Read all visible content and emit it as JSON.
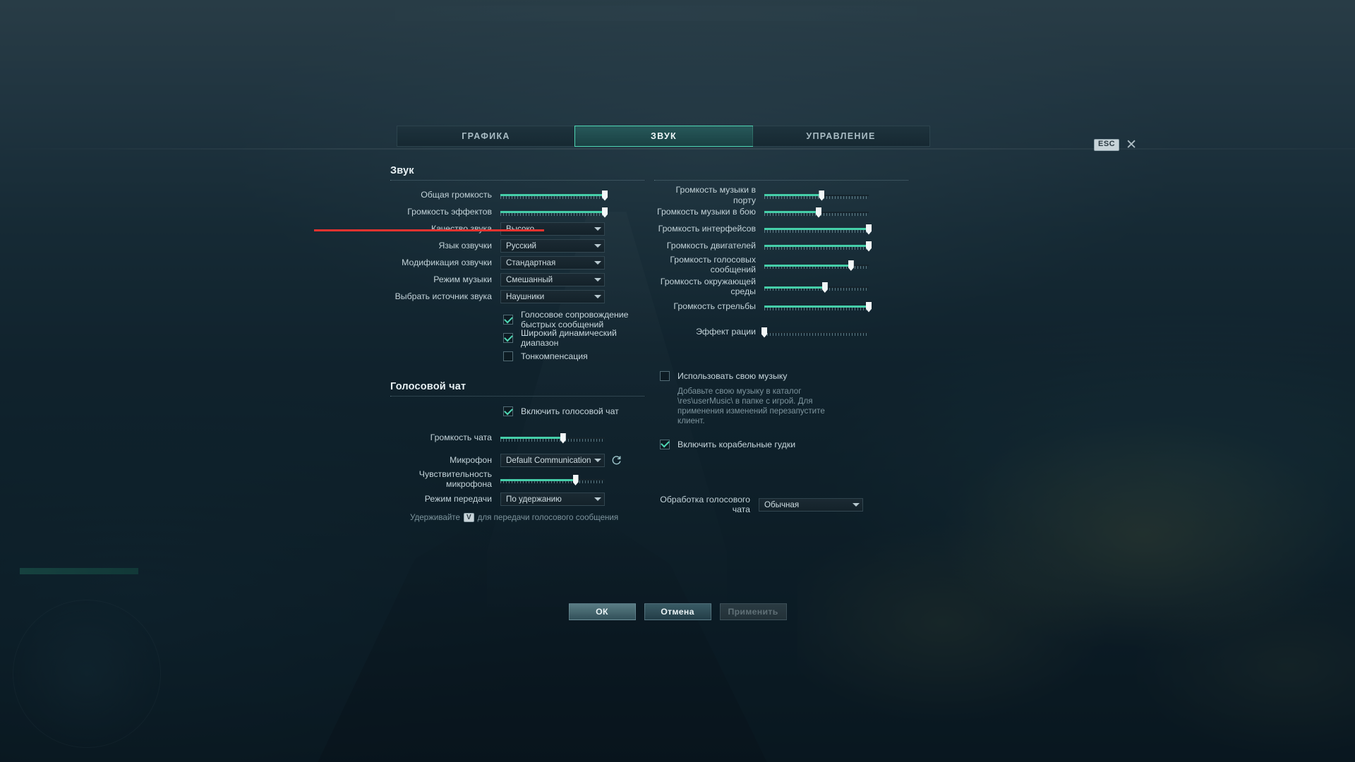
{
  "tabs": [
    {
      "id": "graphics",
      "label": "ГРАФИКА",
      "active": false
    },
    {
      "id": "sound",
      "label": "ЗВУК",
      "active": true
    },
    {
      "id": "controls",
      "label": "УПРАВЛЕНИЕ",
      "active": false
    }
  ],
  "esc_close": {
    "key_label": "ESC",
    "close_glyph": "✕"
  },
  "sections": {
    "sound_title": "Звук",
    "voice_chat_title": "Голосовой чат"
  },
  "left_column": {
    "sliders": [
      {
        "label": "Общая громкость",
        "value": 100
      },
      {
        "label": "Громкость эффектов",
        "value": 100
      }
    ],
    "dropdowns": [
      {
        "label": "Качество звука",
        "value": "Высоко"
      },
      {
        "label": "Язык озвучки",
        "value": "Русский"
      },
      {
        "label": "Модификация озвучки",
        "value": "Стандартная"
      },
      {
        "label": "Режим музыки",
        "value": "Смешанный"
      },
      {
        "label": "Выбрать источник звука",
        "value": "Наушники"
      }
    ],
    "checkboxes": [
      {
        "label": "Голосовое сопровождение быстрых сообщений",
        "checked": true
      },
      {
        "label": "Широкий динамический диапазон",
        "checked": true
      },
      {
        "label": "Тонкомпенсация",
        "checked": false
      }
    ]
  },
  "voice_chat": {
    "enable_checkbox": {
      "label": "Включить голосовой чат",
      "checked": true
    },
    "chat_volume": {
      "label": "Громкость чата",
      "value": 60
    },
    "microphone": {
      "label": "Микрофон",
      "value": "Default Communication Device",
      "refresh_icon": "refresh-icon"
    },
    "mic_sensitivity": {
      "label": "Чувствительность микрофона",
      "value": 72
    },
    "transmit_mode": {
      "label": "Режим передачи",
      "value": "По удержанию"
    },
    "hint_prefix": "Удерживайте",
    "hint_key": "V",
    "hint_suffix": "для передачи голосового сообщения"
  },
  "right_column": {
    "sliders": [
      {
        "label": "Громкость музыки в порту",
        "value": 55
      },
      {
        "label": "Громкость музыки в бою",
        "value": 52
      },
      {
        "label": "Громкость интерфейсов",
        "value": 100
      },
      {
        "label": "Громкость двигателей",
        "value": 100
      },
      {
        "label": "Громкость голосовых сообщений",
        "value": 83
      },
      {
        "label": "Громкость окружающей среды",
        "value": 58
      },
      {
        "label": "Громкость стрельбы",
        "value": 100
      },
      {
        "label": "Эффект рации",
        "value": 0
      }
    ],
    "user_music": {
      "checkbox_label": "Использовать свою музыку",
      "checked": false,
      "hint": "Добавьте свою музыку в каталог \\res\\userMusic\\ в папке с игрой. Для применения изменений перезапустите клиент."
    },
    "ship_horns": {
      "label": "Включить корабельные гудки",
      "checked": true
    },
    "voice_processing": {
      "label": "Обработка голосового чата",
      "value": "Обычная"
    }
  },
  "footer": {
    "ok_label": "ОК",
    "cancel_label": "Отмена",
    "apply_label": "Применить"
  },
  "colors": {
    "accent_green": "#45cfa9",
    "annotation_red": "#e8332f",
    "text_primary": "#e8f1f4",
    "text_secondary": "#c3d3d9",
    "text_muted": "#7d949d"
  }
}
